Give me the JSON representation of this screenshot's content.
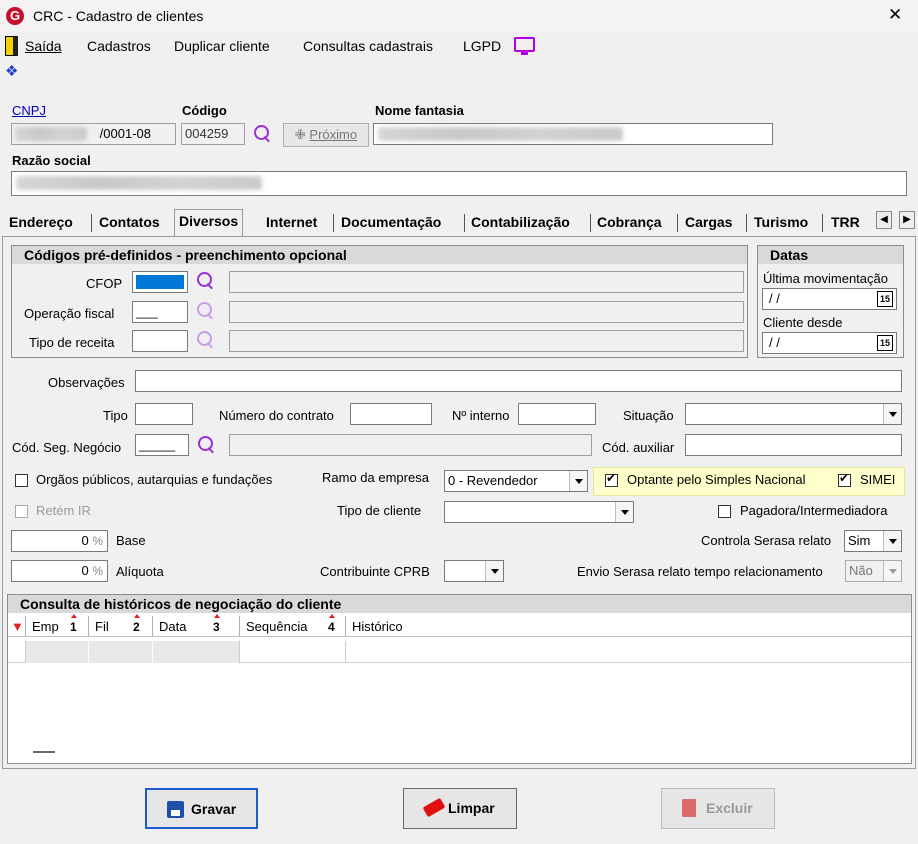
{
  "window": {
    "title": "CRC - Cadastro de clientes",
    "logo": "G",
    "close": "✕"
  },
  "menu": {
    "exit": "Saída",
    "registrations": "Cadastros",
    "duplicate": "Duplicar cliente",
    "queries": "Consultas cadastrais",
    "lgpd": "LGPD"
  },
  "header": {
    "cnpj_label": "CNPJ",
    "cnpj_value": "/0001-08",
    "code_label": "Código",
    "code_value": "004259",
    "next_label": "Próximo",
    "trade_name_label": "Nome fantasia",
    "company_name_label": "Razão social"
  },
  "tabs": [
    "Endereço",
    "Contatos",
    "Diversos",
    "Internet",
    "Documentação",
    "Contabilização",
    "Cobrança",
    "Cargas",
    "Turismo",
    "TRR"
  ],
  "active_tab": "Diversos",
  "predefined": {
    "title": "Códigos pré-definidos - preenchimento opcional",
    "cfop_label": "CFOP",
    "fiscal_op_label": "Operação fiscal",
    "fiscal_op_value": "___",
    "revenue_type_label": "Tipo de receita"
  },
  "dates": {
    "title": "Datas",
    "last_move_label": "Última movimentação",
    "last_move_value": "/ /",
    "client_since_label": "Cliente desde",
    "client_since_value": "/ /",
    "calendar_glyph": "15"
  },
  "form": {
    "observations_label": "Observações",
    "type_label": "Tipo",
    "contract_label": "Número do contrato",
    "internal_no_label": "Nº interno",
    "status_label": "Situação",
    "seg_code_label": "Cód. Seg. Negócio",
    "seg_code_value": "_____",
    "aux_code_label": "Cód. auxiliar",
    "public_org_label": "Orgãos públicos, autarquias e fundações",
    "branch_label": "Ramo da empresa",
    "branch_value": "0 - Revendedor",
    "simples_label": "Optante pelo Simples Nacional",
    "simei_label": "SIMEI",
    "retain_ir_label": "Retém IR",
    "client_type_label": "Tipo de cliente",
    "payer_label": "Pagadora/Intermediadora",
    "base_label": "Base",
    "base_value": "0",
    "rate_label": "Alíquota",
    "rate_value": "0",
    "percent": "%",
    "serasa_label": "Controla Serasa relato",
    "serasa_value": "Sim",
    "cprb_label": "Contribuinte CPRB",
    "serasa_time_label": "Envio Serasa relato tempo relacionamento",
    "serasa_time_value": "Não"
  },
  "history": {
    "title": "Consulta de históricos de negociação do cliente",
    "columns": [
      {
        "label": "Emp",
        "sort": "1"
      },
      {
        "label": "Fil",
        "sort": "2"
      },
      {
        "label": "Data",
        "sort": "3"
      },
      {
        "label": "Sequência",
        "sort": "4"
      },
      {
        "label": "Histórico",
        "sort": ""
      }
    ]
  },
  "buttons": {
    "save": "Gravar",
    "clear": "Limpar",
    "delete": "Excluir"
  }
}
